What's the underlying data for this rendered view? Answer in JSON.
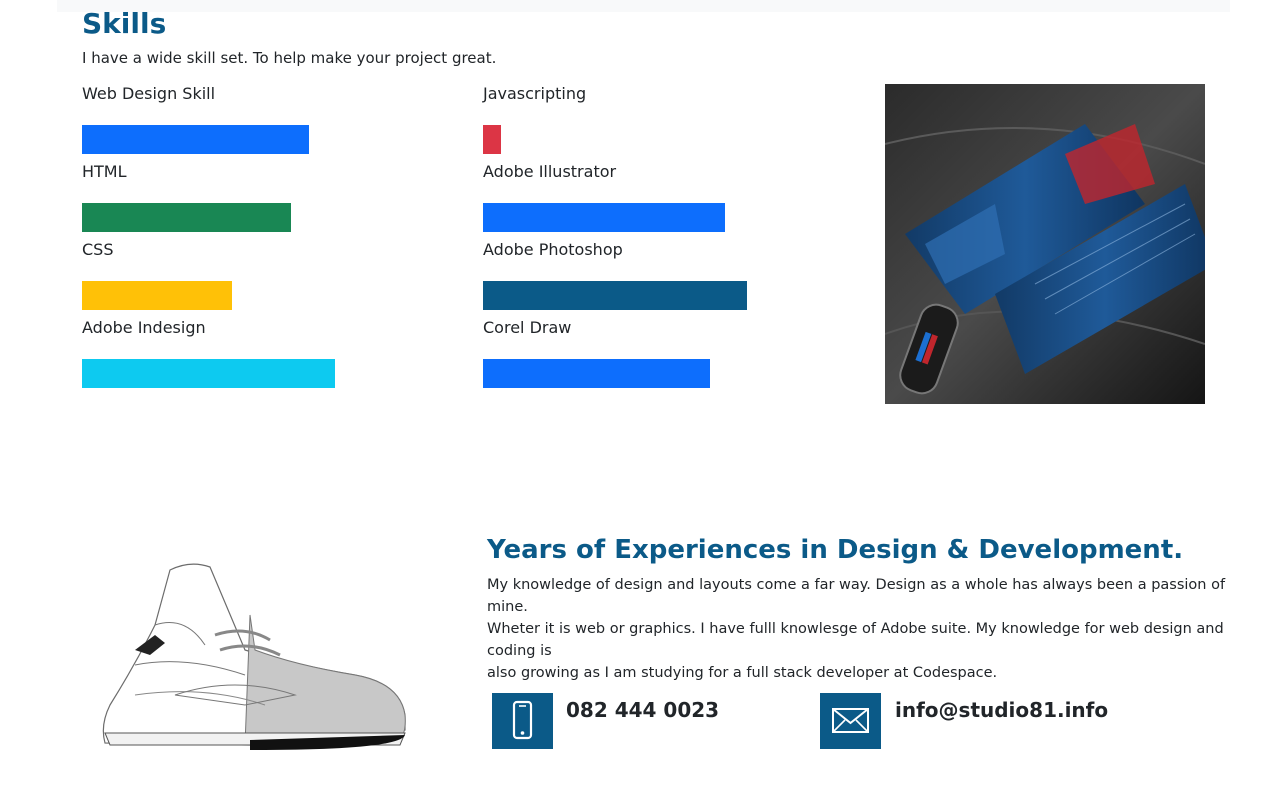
{
  "skills": {
    "title": "Skills",
    "subtitle": "I have a wide skill set. To help make your project great.",
    "left": [
      {
        "label": "Web Design Skill",
        "level": 0.62,
        "color": "#0d6efd"
      },
      {
        "label": "HTML",
        "level": 0.57,
        "color": "#198754"
      },
      {
        "label": "CSS",
        "level": 0.41,
        "color": "#ffc107"
      },
      {
        "label": "Adobe Indesign",
        "level": 0.69,
        "color": "#0dcaf0"
      }
    ],
    "right": [
      {
        "label": "Javascripting",
        "level": 0.05,
        "color": "#dc3545"
      },
      {
        "label": "Adobe Illustrator",
        "level": 0.66,
        "color": "#0d6efd"
      },
      {
        "label": "Adobe Photoshop",
        "level": 0.72,
        "color": "#0b5a88"
      },
      {
        "label": "Corel Draw",
        "level": 0.62,
        "color": "#0d6efd"
      }
    ]
  },
  "experience": {
    "title": "Years of Experiences in Design & Development.",
    "text": "My knowledge of design and layouts come a far way. Design as a whole has always been a passion of mine.\nWheter it is web or graphics. I have fulll knowlesge of Adobe suite. My knowledge for web design and coding is\nalso growing as I am studying for a full stack developer at Codespace."
  },
  "contact": {
    "phone": "082 444 0023",
    "email": "info@studio81.info"
  },
  "colors": {
    "brand": "#0b5a88"
  },
  "icons": {
    "phone": "mobile-phone-icon",
    "email": "envelope-icon"
  }
}
